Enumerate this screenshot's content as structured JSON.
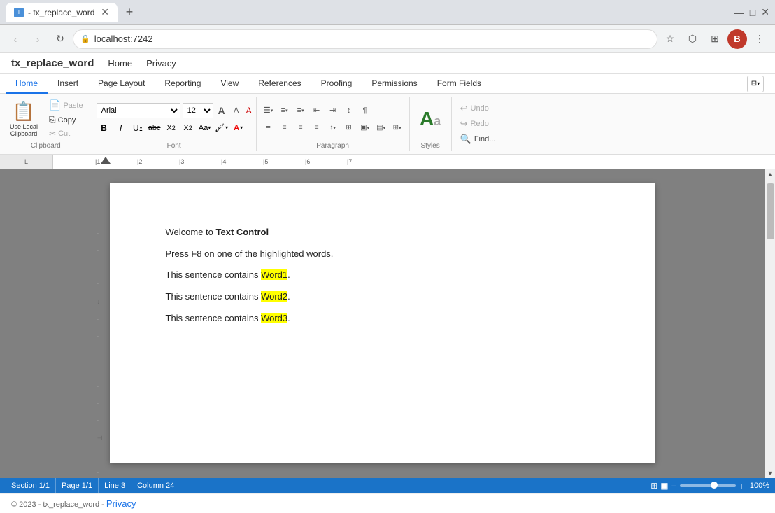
{
  "browser": {
    "tab_title": "- tx_replace_word",
    "new_tab_label": "+",
    "address": "localhost:7242",
    "nav_back": "‹",
    "nav_forward": "›",
    "nav_refresh": "↻",
    "profile_initial": "B",
    "collapse_label": "⊟"
  },
  "app": {
    "logo": "tx_replace_word",
    "nav_home": "Home",
    "nav_privacy": "Privacy"
  },
  "ribbon": {
    "tabs": [
      "Home",
      "Insert",
      "Page Layout",
      "Reporting",
      "View",
      "References",
      "Proofing",
      "Permissions",
      "Form Fields"
    ],
    "active_tab": "Home",
    "clipboard": {
      "label": "Clipboard",
      "use_local": "Use Local\nClipboard",
      "paste": "Paste",
      "copy": "Copy",
      "cut": "Cut"
    },
    "font": {
      "label": "Font",
      "name": "Arial",
      "size": "12",
      "bold": "B",
      "italic": "I",
      "underline": "U",
      "strikethrough": "abc",
      "subscript": "X₂",
      "superscript": "X²",
      "case": "Aa▾",
      "grow": "A",
      "shrink": "A",
      "clear": "A"
    },
    "paragraph": {
      "label": "Paragraph",
      "expand_icon": "⌄"
    },
    "styles": {
      "label": "Styles",
      "aa_label": "Styles"
    },
    "editing": {
      "undo": "Undo",
      "redo": "Redo",
      "find": "Find..."
    }
  },
  "document": {
    "content": [
      {
        "type": "heading",
        "text": "Welcome to ",
        "bold_part": "Text Control"
      },
      {
        "type": "normal",
        "text": "Press F8 on one of the highlighted words."
      },
      {
        "type": "normal",
        "text": "This sentence contains ",
        "highlight": "Word1",
        "after": "."
      },
      {
        "type": "normal",
        "text": "This sentence contains ",
        "highlight": "Word2",
        "after": "."
      },
      {
        "type": "normal",
        "text": "This sentence contains ",
        "highlight": "Word3",
        "after": "."
      }
    ]
  },
  "status": {
    "section": "Section 1/1",
    "page": "Page 1/1",
    "line": "Line 3",
    "column": "Column 24",
    "zoom": "100%",
    "zoom_minus": "−",
    "zoom_plus": "+"
  },
  "footer": {
    "copyright": "© 2023 - tx_replace_word -",
    "privacy_link": "Privacy"
  }
}
